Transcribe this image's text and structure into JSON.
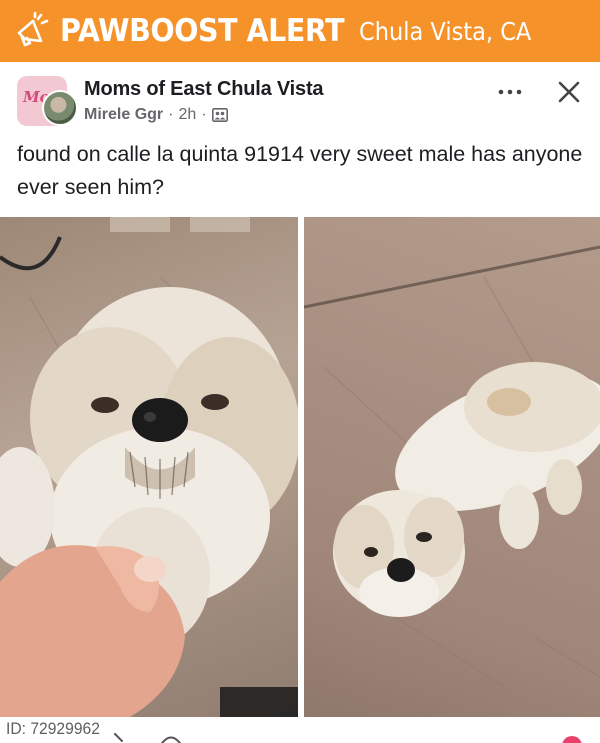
{
  "alert": {
    "title": "PAWBOOST ALERT",
    "location": "Chula Vista, CA",
    "icon": "megaphone-icon",
    "bg_color": "#f5922a",
    "text_color": "#ffffff"
  },
  "post": {
    "group_name": "Moms of East Chula Vista",
    "author": "Mirele Ggr",
    "separator": "·",
    "time": "2h",
    "group_icon": "group-members-icon",
    "more_icon": "more-dots-icon",
    "close_icon": "close-icon",
    "avatar_text": "Mo",
    "caption": "found on calle la quinta 91914 very sweet male has anyone ever seen him?"
  },
  "photos": [
    {
      "subject": "dog-photo-closeup"
    },
    {
      "subject": "dog-photo-full"
    }
  ],
  "footer": {
    "id_text": "ID: 72929962"
  }
}
